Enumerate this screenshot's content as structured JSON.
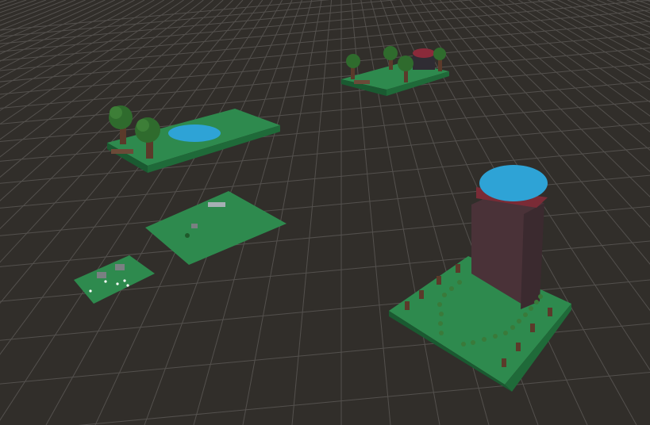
{
  "scene": {
    "view": "3d-scene-viewport",
    "colors": {
      "background": "#312e2a",
      "grid_line": "#5a5754",
      "grass": "#2e8a4e",
      "grass_side": "#1f6a39",
      "water": "#2ea3d6",
      "trunk": "#5b3a2a",
      "foliage": "#2f6b2d",
      "tower": "#4a3238",
      "tower_band": "#7a2b36"
    },
    "objects": [
      {
        "name": "park-island-tile"
      },
      {
        "name": "gazebo-island-tile"
      },
      {
        "name": "plain-grass-tile"
      },
      {
        "name": "small-grass-tile"
      },
      {
        "name": "tower-plaza-tile"
      }
    ]
  }
}
